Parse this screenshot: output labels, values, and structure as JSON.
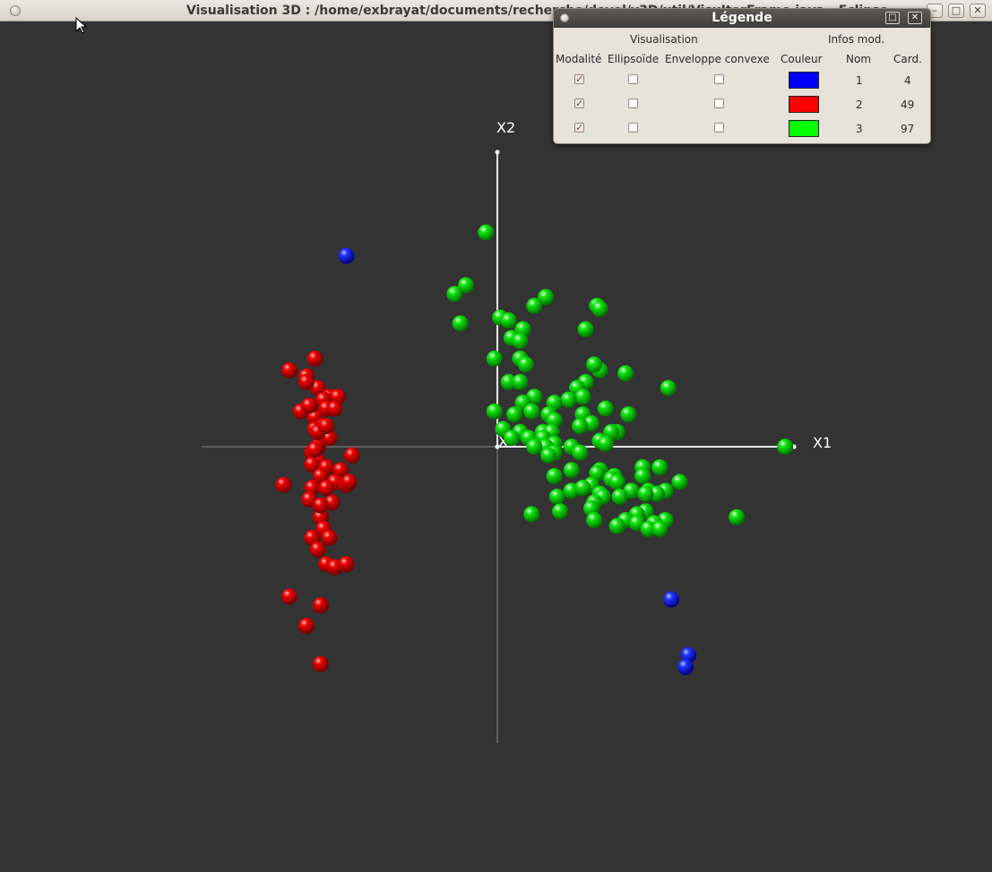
{
  "window": {
    "title": "Visualisation 3D : /home/exbrayat/documents/recherche/devel/v3D/util/VisuIterFrame.java - Eclipse"
  },
  "legend": {
    "title": "Légende",
    "group_headers": {
      "visualisation": "Visualisation",
      "infos": "Infos mod."
    },
    "columns": {
      "modalite": "Modalité",
      "ellipsoide": "Ellipsoïde",
      "enveloppe": "Enveloppe convexe",
      "couleur": "Couleur",
      "nom": "Nom",
      "card": "Card."
    },
    "rows": [
      {
        "modalite": true,
        "ellipsoide": false,
        "enveloppe": false,
        "color": "#0000ff",
        "nom": "1",
        "card": "4"
      },
      {
        "modalite": true,
        "ellipsoide": false,
        "enveloppe": false,
        "color": "#ff0000",
        "nom": "2",
        "card": "49"
      },
      {
        "modalite": true,
        "ellipsoide": false,
        "enveloppe": false,
        "color": "#00ff00",
        "nom": "3",
        "card": "97"
      }
    ]
  },
  "chart_data": {
    "type": "scatter",
    "axes": {
      "x": "X1",
      "y": "X2",
      "z": "X3"
    },
    "xlim": [
      -1.04,
      1.04
    ],
    "ylim": [
      -1.01,
      1.01
    ],
    "series": [
      {
        "name": "1",
        "color": "#0000ff",
        "points": [
          [
            -0.53,
            0.65
          ],
          [
            0.61,
            -0.52
          ],
          [
            0.67,
            -0.71
          ],
          [
            0.66,
            -0.75
          ]
        ]
      },
      {
        "name": "2",
        "color": "#ff0000",
        "points": [
          [
            -0.73,
            0.26
          ],
          [
            -0.64,
            0.3
          ],
          [
            -0.67,
            0.24
          ],
          [
            -0.63,
            0.2
          ],
          [
            -0.59,
            0.17
          ],
          [
            -0.56,
            0.17
          ],
          [
            -0.61,
            0.16
          ],
          [
            -0.69,
            0.12
          ],
          [
            -0.64,
            0.1
          ],
          [
            -0.61,
            0.07
          ],
          [
            -0.62,
            0.03
          ],
          [
            -0.65,
            -0.02
          ],
          [
            -0.63,
            -0.05
          ],
          [
            -0.65,
            -0.06
          ],
          [
            -0.6,
            -0.07
          ],
          [
            -0.55,
            -0.08
          ],
          [
            -0.51,
            -0.03
          ],
          [
            -0.62,
            -0.1
          ],
          [
            -0.57,
            -0.12
          ],
          [
            -0.53,
            -0.13
          ],
          [
            -0.52,
            -0.12
          ],
          [
            -0.75,
            -0.13
          ],
          [
            -0.65,
            -0.14
          ],
          [
            -0.58,
            -0.19
          ],
          [
            -0.66,
            -0.18
          ],
          [
            -0.62,
            -0.24
          ],
          [
            -0.61,
            -0.28
          ],
          [
            -0.65,
            -0.31
          ],
          [
            -0.59,
            -0.31
          ],
          [
            -0.6,
            -0.4
          ],
          [
            -0.57,
            -0.41
          ],
          [
            -0.53,
            -0.4
          ],
          [
            -0.73,
            -0.51
          ],
          [
            -0.62,
            -0.54
          ],
          [
            -0.67,
            -0.61
          ],
          [
            -0.62,
            -0.74
          ],
          [
            -0.63,
            0.0
          ],
          [
            -0.64,
            0.06
          ],
          [
            -0.6,
            -0.14
          ],
          [
            -0.59,
            0.03
          ],
          [
            -0.6,
            0.13
          ],
          [
            -0.66,
            0.14
          ],
          [
            -0.62,
            -0.2
          ],
          [
            -0.63,
            0.05
          ],
          [
            -0.67,
            0.22
          ],
          [
            -0.6,
            0.07
          ],
          [
            -0.57,
            0.13
          ],
          [
            -0.64,
            -0.01
          ],
          [
            -0.63,
            -0.35
          ]
        ]
      },
      {
        "name": "3",
        "color": "#00ff00",
        "points": [
          [
            -0.04,
            0.73
          ],
          [
            -0.15,
            0.52
          ],
          [
            -0.11,
            0.55
          ],
          [
            0.17,
            0.51
          ],
          [
            0.13,
            0.48
          ],
          [
            0.35,
            0.48
          ],
          [
            0.36,
            0.47
          ],
          [
            0.01,
            0.44
          ],
          [
            0.04,
            0.43
          ],
          [
            -0.13,
            0.42
          ],
          [
            0.31,
            0.4
          ],
          [
            0.09,
            0.4
          ],
          [
            0.05,
            0.37
          ],
          [
            0.08,
            0.36
          ],
          [
            0.08,
            0.3
          ],
          [
            -0.01,
            0.3
          ],
          [
            0.1,
            0.28
          ],
          [
            0.36,
            0.26
          ],
          [
            0.34,
            0.28
          ],
          [
            0.45,
            0.25
          ],
          [
            0.04,
            0.22
          ],
          [
            0.08,
            0.22
          ],
          [
            0.6,
            0.2
          ],
          [
            0.31,
            0.22
          ],
          [
            0.28,
            0.2
          ],
          [
            0.3,
            0.17
          ],
          [
            0.13,
            0.17
          ],
          [
            0.25,
            0.16
          ],
          [
            0.09,
            0.15
          ],
          [
            0.2,
            0.15
          ],
          [
            0.38,
            0.13
          ],
          [
            -0.01,
            0.12
          ],
          [
            0.12,
            0.12
          ],
          [
            0.18,
            0.11
          ],
          [
            0.06,
            0.11
          ],
          [
            0.3,
            0.11
          ],
          [
            0.46,
            0.11
          ],
          [
            0.2,
            0.09
          ],
          [
            0.33,
            0.08
          ],
          [
            0.29,
            0.07
          ],
          [
            0.02,
            0.06
          ],
          [
            0.08,
            0.05
          ],
          [
            0.16,
            0.05
          ],
          [
            0.19,
            0.05
          ],
          [
            0.42,
            0.05
          ],
          [
            0.4,
            0.05
          ],
          [
            0.05,
            0.03
          ],
          [
            0.11,
            0.03
          ],
          [
            0.16,
            0.03
          ],
          [
            0.2,
            0.01
          ],
          [
            0.17,
            0.0
          ],
          [
            0.36,
            0.02
          ],
          [
            0.38,
            0.01
          ],
          [
            0.13,
            0.0
          ],
          [
            0.26,
            0.0
          ],
          [
            1.01,
            0.0
          ],
          [
            0.2,
            -0.02
          ],
          [
            0.18,
            -0.03
          ],
          [
            0.29,
            -0.02
          ],
          [
            0.57,
            -0.07
          ],
          [
            0.51,
            -0.07
          ],
          [
            0.36,
            -0.08
          ],
          [
            0.26,
            -0.08
          ],
          [
            0.2,
            -0.1
          ],
          [
            0.41,
            -0.1
          ],
          [
            0.51,
            -0.1
          ],
          [
            0.35,
            -0.09
          ],
          [
            0.4,
            -0.11
          ],
          [
            0.64,
            -0.12
          ],
          [
            0.42,
            -0.12
          ],
          [
            0.33,
            -0.13
          ],
          [
            0.53,
            -0.15
          ],
          [
            0.47,
            -0.15
          ],
          [
            0.59,
            -0.15
          ],
          [
            0.26,
            -0.15
          ],
          [
            0.3,
            -0.14
          ],
          [
            0.21,
            -0.17
          ],
          [
            0.36,
            -0.16
          ],
          [
            0.43,
            -0.17
          ],
          [
            0.56,
            -0.16
          ],
          [
            0.52,
            -0.16
          ],
          [
            0.37,
            -0.17
          ],
          [
            0.34,
            -0.19
          ],
          [
            0.33,
            -0.21
          ],
          [
            0.22,
            -0.22
          ],
          [
            0.12,
            -0.23
          ],
          [
            0.52,
            -0.22
          ],
          [
            0.49,
            -0.23
          ],
          [
            0.34,
            -0.25
          ],
          [
            0.45,
            -0.25
          ],
          [
            0.59,
            -0.25
          ],
          [
            0.49,
            -0.26
          ],
          [
            0.42,
            -0.27
          ],
          [
            0.55,
            -0.26
          ],
          [
            0.53,
            -0.28
          ],
          [
            0.57,
            -0.28
          ],
          [
            0.84,
            -0.24
          ]
        ]
      }
    ]
  }
}
